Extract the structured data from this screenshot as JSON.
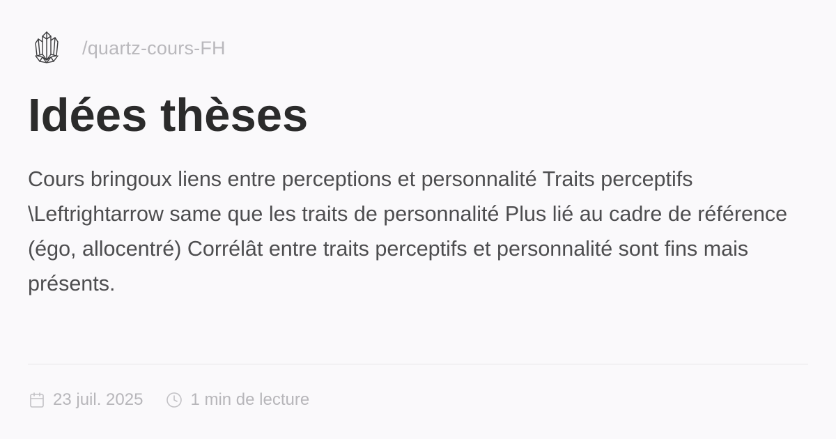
{
  "site": {
    "logo_icon": "crystal-quartz-icon",
    "path": "/quartz-cours-FH"
  },
  "page": {
    "title": "Idées thèses",
    "description": "Cours bringoux liens entre perceptions et personnalité Traits perceptifs \\Leftrightarrow same que les traits de personnalité Plus lié au cadre de référence (égo, allocentré) Corrélât entre traits perceptifs et personnalité sont fins mais présents."
  },
  "meta": {
    "date_icon": "calendar-icon",
    "date": "23 juil. 2025",
    "reading_icon": "clock-icon",
    "reading_time": "1 min de lecture"
  },
  "colors": {
    "background": "#faf9fb",
    "title": "#2b2b2b",
    "body_text": "#4d4d4f",
    "muted": "#b7b6ba"
  }
}
